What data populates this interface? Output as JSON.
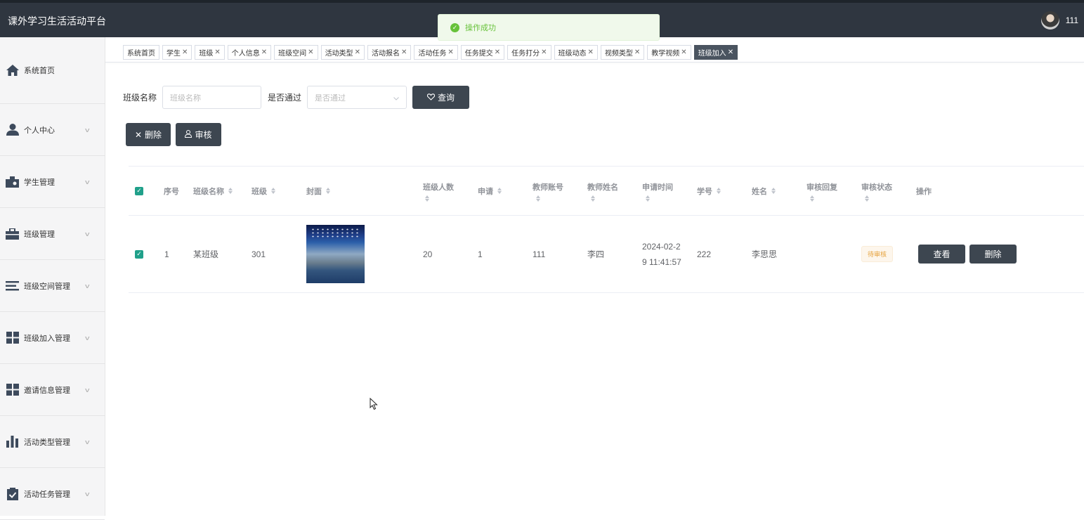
{
  "app": {
    "title": "课外学习生活活动平台",
    "user_name": "111"
  },
  "toast": {
    "message": "操作成功"
  },
  "sidebar": {
    "items": [
      {
        "label": "系统首页",
        "icon": "home-icon",
        "has_arrow": false
      },
      {
        "label": "个人中心",
        "icon": "person-icon",
        "has_arrow": true
      },
      {
        "label": "学生管理",
        "icon": "id-card-icon",
        "has_arrow": true
      },
      {
        "label": "班级管理",
        "icon": "briefcase-icon",
        "has_arrow": true
      },
      {
        "label": "班级空间管理",
        "icon": "list-icon",
        "has_arrow": true
      },
      {
        "label": "班级加入管理",
        "icon": "grid-icon",
        "has_arrow": true
      },
      {
        "label": "邀请信息管理",
        "icon": "grid-icon",
        "has_arrow": true
      },
      {
        "label": "活动类型管理",
        "icon": "bar-chart-icon",
        "has_arrow": true
      },
      {
        "label": "活动任务管理",
        "icon": "clipboard-icon",
        "has_arrow": true
      }
    ]
  },
  "tabs": [
    {
      "label": "系统首页",
      "closable": false
    },
    {
      "label": "学生",
      "closable": true
    },
    {
      "label": "班级",
      "closable": true
    },
    {
      "label": "个人信息",
      "closable": true
    },
    {
      "label": "班级空间",
      "closable": true
    },
    {
      "label": "活动类型",
      "closable": true
    },
    {
      "label": "活动报名",
      "closable": true
    },
    {
      "label": "活动任务",
      "closable": true
    },
    {
      "label": "任务提交",
      "closable": true
    },
    {
      "label": "任务打分",
      "closable": true
    },
    {
      "label": "班级动态",
      "closable": true
    },
    {
      "label": "视频类型",
      "closable": true
    },
    {
      "label": "教学视频",
      "closable": true
    },
    {
      "label": "班级加入",
      "closable": true,
      "active": true
    }
  ],
  "search": {
    "class_name_label": "班级名称",
    "class_name_placeholder": "班级名称",
    "passed_label": "是否通过",
    "passed_placeholder": "是否通过",
    "query_button": "查询"
  },
  "actions": {
    "delete_button": "删除",
    "review_button": "审核"
  },
  "table": {
    "headers": {
      "index": "序号",
      "class_name": "班级名称",
      "class": "班级",
      "cover": "封面",
      "class_size": "班级人数",
      "apply": "申请",
      "teacher_account": "教师账号",
      "teacher_name": "教师姓名",
      "apply_time": "申请时间",
      "student_no": "学号",
      "name": "姓名",
      "review_reply": "审核回复",
      "review_status": "审核状态",
      "operation": "操作"
    },
    "rows": [
      {
        "index": "1",
        "class_name": "某班级",
        "class": "301",
        "class_size": "20",
        "apply": "1",
        "teacher_account": "111",
        "teacher_name": "李四",
        "apply_time_line1": "2024-02-2",
        "apply_time_line2": "9 11:41:57",
        "student_no": "222",
        "name": "李思思",
        "review_reply": "",
        "review_status": "待审核",
        "view_button": "查看",
        "delete_button": "删除"
      }
    ]
  },
  "colors": {
    "topbar": "#2f3640",
    "button_dark": "#3d4650",
    "checkbox": "#20a08a",
    "success": "#67c23a",
    "warning": "#e6a23c"
  }
}
